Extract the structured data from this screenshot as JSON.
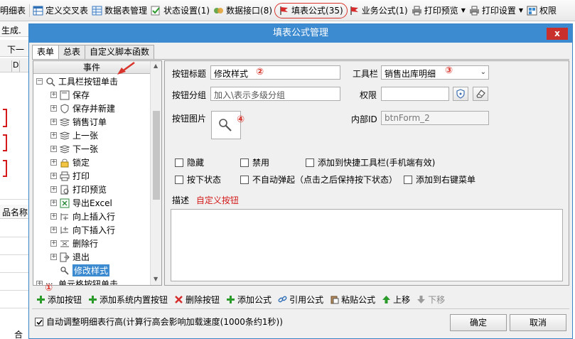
{
  "toolbar": {
    "items": [
      {
        "label": "明细表",
        "partial": true
      },
      {
        "label": "定义交叉表"
      },
      {
        "label": "数据表管理"
      },
      {
        "label": "状态设置(1)"
      },
      {
        "label": "数据接口(8)"
      },
      {
        "label": "填表公式(35)",
        "highlighted": true
      },
      {
        "label": "业务公式(1)"
      },
      {
        "label": "打印预览"
      },
      {
        "label": "打印设置"
      },
      {
        "label": "权限"
      }
    ]
  },
  "background": {
    "strip_label": "生成.",
    "next_label": "下一",
    "grid_col": "D",
    "product_name": "品名称",
    "total_label": "合"
  },
  "dialog": {
    "title": "填表公式管理",
    "close_symbol": "x",
    "tabs": [
      "表单",
      "总表",
      "自定义脚本函数"
    ],
    "active_tab": 0
  },
  "tree": {
    "header": "事件",
    "root_label": "工具栏按钮单击",
    "children": [
      {
        "label": "保存",
        "icon": "save-icon"
      },
      {
        "label": "保存并新建",
        "icon": "shield-icon"
      },
      {
        "label": "销售订单",
        "icon": "layers-icon"
      },
      {
        "label": "上一张",
        "icon": "layers-icon"
      },
      {
        "label": "下一张",
        "icon": "layers-icon"
      },
      {
        "label": "锁定",
        "icon": "lock-icon"
      },
      {
        "label": "打印",
        "icon": "printer-icon"
      },
      {
        "label": "打印预览",
        "icon": "preview-icon"
      },
      {
        "label": "导出Excel",
        "icon": "excel-icon"
      },
      {
        "label": "向上插入行",
        "icon": "insert-up-icon"
      },
      {
        "label": "向下插入行",
        "icon": "insert-down-icon"
      },
      {
        "label": "删除行",
        "icon": "delete-row-icon"
      },
      {
        "label": "退出",
        "icon": "exit-icon"
      },
      {
        "label": "修改样式",
        "icon": "wrench-icon",
        "selected": true
      }
    ],
    "next_root_label": "单元格按钮单击"
  },
  "form": {
    "button_title_label": "按钮标题",
    "button_title_value": "修改样式",
    "toolbar_label": "工具栏",
    "toolbar_value": "销售出库明细",
    "group_label": "按钮分组",
    "group_placeholder": "加入\\表示多级分组",
    "permission_label": "权限",
    "permission_value": "",
    "image_label": "按钮图片",
    "internal_id_label": "内部ID",
    "internal_id_value": "btnForm_2",
    "checkboxes_row1": [
      "隐藏",
      "禁用",
      "添加到快捷工具栏(手机端有效)"
    ],
    "checkboxes_row2": [
      "按下状态",
      "不自动弹起（点击之后保持按下状态）",
      "添加到右键菜单"
    ],
    "desc_label": "描述",
    "desc_value": "自定义按钮"
  },
  "annotations": [
    "①",
    "②",
    "③",
    "④"
  ],
  "actions": [
    {
      "label": "添加按钮",
      "icon": "plus-icon"
    },
    {
      "label": "添加系统内置按钮",
      "icon": "plus-icon"
    },
    {
      "label": "删除按钮",
      "icon": "delete-x-icon"
    },
    {
      "label": "添加公式",
      "icon": "plus-icon"
    },
    {
      "label": "引用公式",
      "icon": "link-icon"
    },
    {
      "label": "粘贴公式",
      "icon": "paste-icon"
    },
    {
      "label": "上移",
      "icon": "arrow-up-icon"
    },
    {
      "label": "下移",
      "icon": "arrow-down-icon",
      "disabled": true
    }
  ],
  "footer": {
    "auto_adjust_label": "自动调整明细表行高(计算行高会影响加载速度(1000条约1秒))",
    "auto_adjust_checked": true,
    "ok_label": "确定",
    "cancel_label": "取消"
  },
  "colors": {
    "title_bar": "#3c8ad0",
    "close_button": "#c9302c",
    "annotation_red": "#d9342b",
    "selection": "#3c8ad0"
  }
}
